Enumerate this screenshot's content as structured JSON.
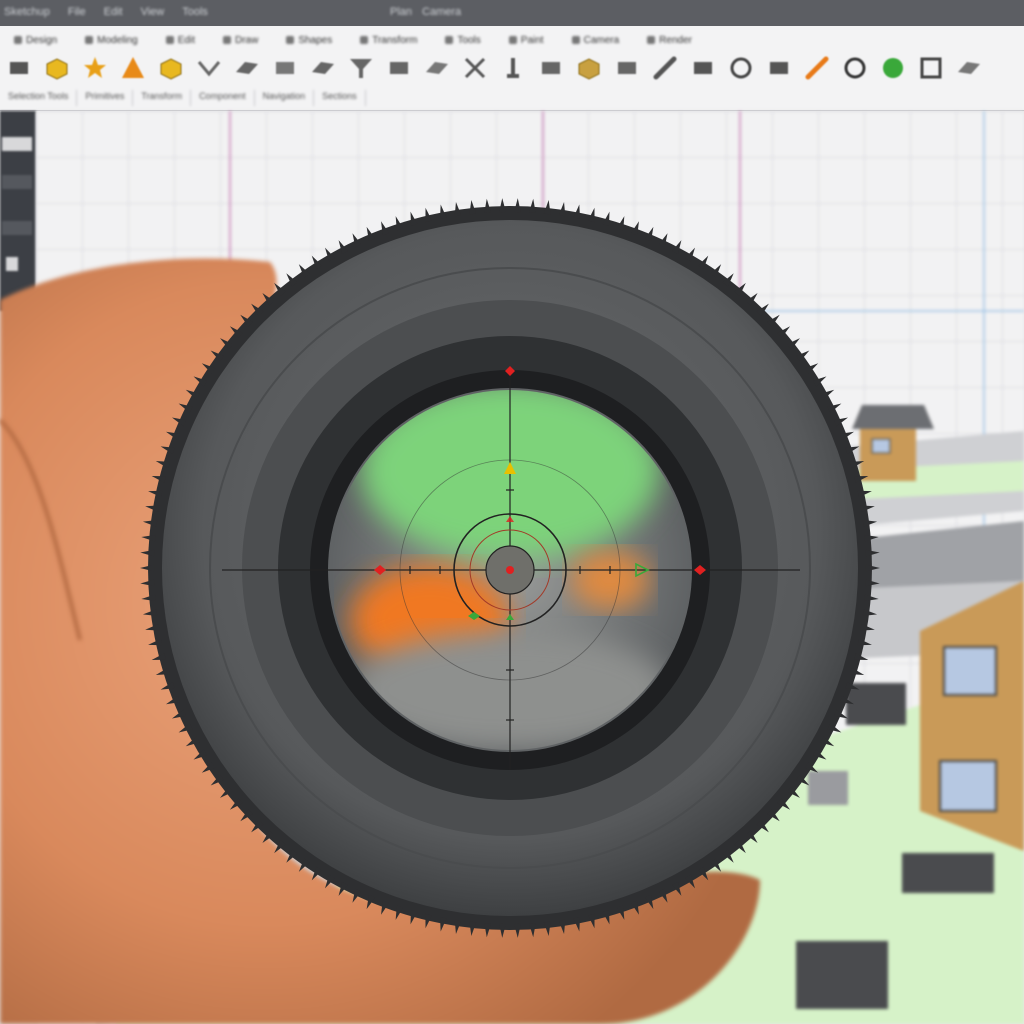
{
  "app": {
    "menu": [
      "Sketchup",
      "File",
      "Edit",
      "View",
      "Tools"
    ],
    "title_parts": [
      "Plan",
      "Camera"
    ]
  },
  "toolbar": {
    "tabs": [
      {
        "label": "Design",
        "icon": "cube-icon"
      },
      {
        "label": "Modeling",
        "icon": "pencil-icon"
      },
      {
        "label": "Edit",
        "icon": "eraser-icon"
      },
      {
        "label": "Draw",
        "icon": "line-icon"
      },
      {
        "label": "Shapes",
        "icon": "shape-icon"
      },
      {
        "label": "Transform",
        "icon": "move-icon"
      },
      {
        "label": "Tools",
        "icon": "wrench-icon"
      },
      {
        "label": "Paint",
        "icon": "bucket-icon"
      },
      {
        "label": "Camera",
        "icon": "camera-icon"
      },
      {
        "label": "Render",
        "icon": "render-icon"
      }
    ],
    "tools": [
      {
        "name": "select-tool-icon",
        "color": "#555555"
      },
      {
        "name": "box-tool-icon",
        "color": "#e8b820"
      },
      {
        "name": "rotate-tool-icon",
        "color": "#e8a018"
      },
      {
        "name": "cone-tool-icon",
        "color": "#e88a18"
      },
      {
        "name": "cube-yellow-icon",
        "color": "#e8b820"
      },
      {
        "name": "line-tool-icon",
        "color": "#666666"
      },
      {
        "name": "plane-tool-icon",
        "color": "#666666"
      },
      {
        "name": "push-pull-icon",
        "color": "#777777"
      },
      {
        "name": "extrude-icon",
        "color": "#666666"
      },
      {
        "name": "funnel-tool-icon",
        "color": "#666666"
      },
      {
        "name": "wall-tool-icon",
        "color": "#666666"
      },
      {
        "name": "beam-tool-icon",
        "color": "#777777"
      },
      {
        "name": "scissor-tool-icon",
        "color": "#555555"
      },
      {
        "name": "pin-tool-icon",
        "color": "#555555"
      },
      {
        "name": "block-tool-icon",
        "color": "#666666"
      },
      {
        "name": "crate-tool-icon",
        "color": "#c8a040"
      },
      {
        "name": "bolt-tool-icon",
        "color": "#666666"
      },
      {
        "name": "knife-tool-icon",
        "color": "#555555"
      },
      {
        "name": "square-tool-icon",
        "color": "#555555"
      },
      {
        "name": "circle-tool-icon",
        "color": "#444444"
      },
      {
        "name": "flag-tool-icon",
        "color": "#555555"
      },
      {
        "name": "brush-tool-icon",
        "color": "#e87a18"
      },
      {
        "name": "eye-tool-icon",
        "color": "#333333"
      },
      {
        "name": "green-dot-icon",
        "color": "#3aa83a"
      },
      {
        "name": "frame-tool-icon",
        "color": "#444444"
      },
      {
        "name": "wedge-tool-icon",
        "color": "#777777"
      }
    ],
    "groups": [
      "Selection Tools",
      "Primitives",
      "Transform",
      "Component",
      "Navigation",
      "Sections"
    ]
  },
  "colors": {
    "lens_body": "#57595b",
    "lens_rim": "#3a3b3d",
    "skin": "#d9895c",
    "ground": "#d6f2c8",
    "house_wall": "#c99a58",
    "reticle_red": "#e02020",
    "reticle_yellow": "#e8c000",
    "reticle_green": "#3aa83a"
  }
}
